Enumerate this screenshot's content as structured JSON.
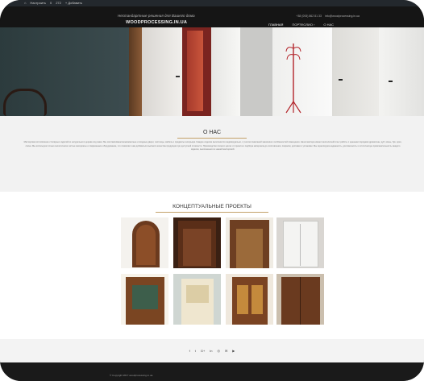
{
  "adminbar": {
    "items": [
      "Настроить",
      "0",
      "272",
      "+ Добавить"
    ]
  },
  "header": {
    "tagline": "Нестандартные решения для Вашего дома",
    "logo": "WOODPROCESSING.IN.UA",
    "contacts": [
      "+38 (093) 862 81 33",
      "info@woodprocessing.in.ua"
    ],
    "nav": [
      "ГЛАВНАЯ",
      "ПОРТФОЛИО ›",
      "О НАС"
    ]
  },
  "about": {
    "title": "О НАС",
    "text": "Мастерская изготовление столярных изделий из натурального дерева под заказ. Мы изготавливаем межкомнатные и входные двери, лестницы, мебель и предметы интерьера. Каждое изделие выполняется индивидуально, с учетом пожеланий заказчика и особенностей помещения. Наши мастера имеют многолетний опыт работы с ценными породами древесины: дуб, ясень, бук, орех, сосна. Мы используем только экологически чистые материалы и современное оборудование, что позволяет нам добиваться высокого качества продукции при доступной стоимости. Производство полного цикла: от проекта и подбора материала до изготовления, покраски, доставки и установки. Мы гарантируем надежность, долговечность и эстетическую привлекательность каждого изделия, выполненного в нашей мастерской."
  },
  "projects": {
    "title": "КОНЦЕПТУАЛЬНЫЕ ПРОЕКТЫ"
  },
  "social": [
    "f",
    "t",
    "G+",
    "in",
    "◎",
    "✉",
    "▶"
  ],
  "footer": {
    "copyright": "© Copyright 2017 woodprocessing.in.ua"
  }
}
